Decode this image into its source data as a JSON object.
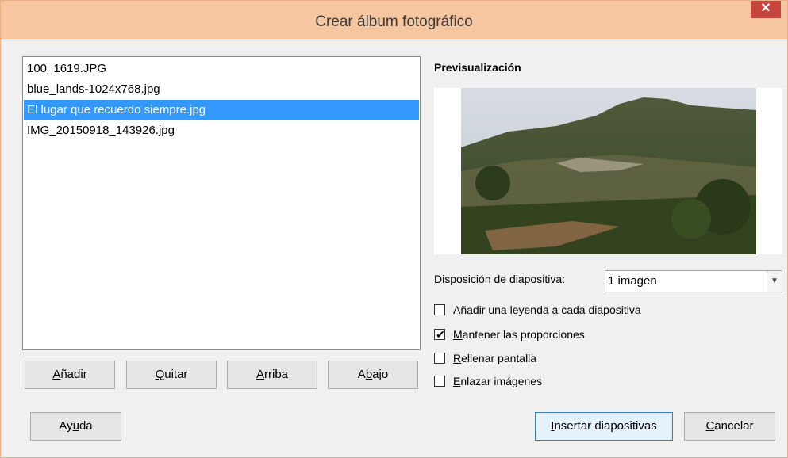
{
  "window": {
    "title": "Crear álbum fotográfico",
    "close_glyph": "✕"
  },
  "files": [
    "100_1619.JPG",
    "blue_lands-1024x768.jpg",
    "El lugar que recuerdo siempre.jpg",
    "IMG_20150918_143926.jpg"
  ],
  "selected_file_index": 2,
  "list_buttons": [
    {
      "name": "add-button",
      "pre": "",
      "mnemonic": "A",
      "post": "ñadir"
    },
    {
      "name": "remove-button",
      "pre": "",
      "mnemonic": "Q",
      "post": "uitar"
    },
    {
      "name": "up-button",
      "pre": "",
      "mnemonic": "A",
      "post": "rriba"
    },
    {
      "name": "down-button",
      "pre": "A",
      "mnemonic": "b",
      "post": "ajo"
    }
  ],
  "preview": {
    "label": "Previsualización"
  },
  "layout": {
    "label_mnemonic": "D",
    "label_rest": "isposición de diapositiva:",
    "value": "1 imagen"
  },
  "options": [
    {
      "name": "add-caption-checkbox",
      "pre": "Añadir una ",
      "mnemonic": "l",
      "post": "eyenda a cada diapositiva",
      "checked": false
    },
    {
      "name": "keep-ratio-checkbox",
      "pre": "",
      "mnemonic": "M",
      "post": "antener las proporciones",
      "checked": true
    },
    {
      "name": "fill-screen-checkbox",
      "pre": "",
      "mnemonic": "R",
      "post": "ellenar pantalla",
      "checked": false
    },
    {
      "name": "link-images-checkbox",
      "pre": "",
      "mnemonic": "E",
      "post": "nlazar imágenes",
      "checked": false
    }
  ],
  "footer": {
    "help": {
      "pre": "Ay",
      "mnemonic": "u",
      "post": "da"
    },
    "insert": {
      "pre": "",
      "mnemonic": "I",
      "post": "nsertar diapositivas"
    },
    "cancel": {
      "pre": "",
      "mnemonic": "C",
      "post": "ancelar"
    }
  },
  "icons": {
    "checkmark": "✔",
    "dropdown": "▼"
  },
  "colors": {
    "titlebar": "#f6c6a1",
    "close": "#c7453c",
    "selection": "#3399ff"
  }
}
